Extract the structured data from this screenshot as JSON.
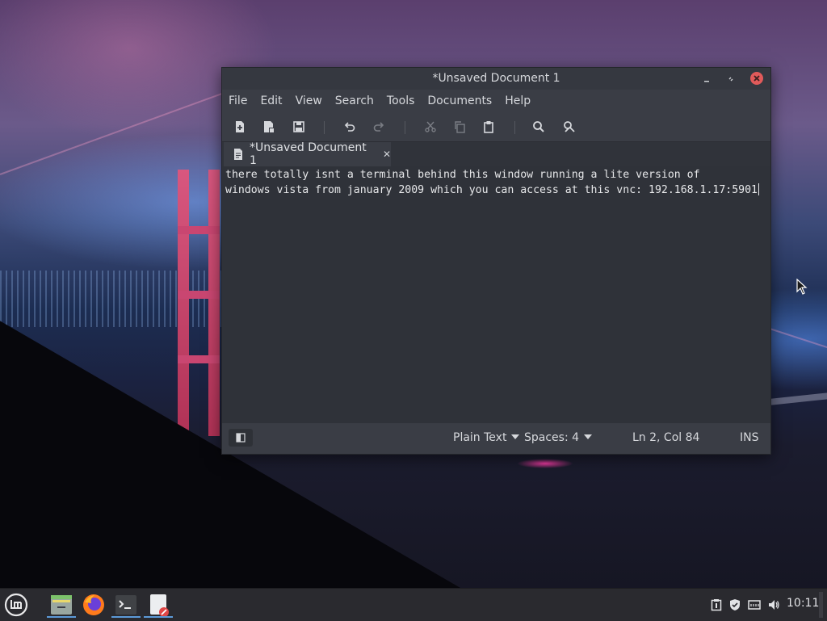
{
  "window": {
    "title": "*Unsaved Document 1",
    "menu": [
      "File",
      "Edit",
      "View",
      "Search",
      "Tools",
      "Documents",
      "Help"
    ],
    "tab_title": "*Unsaved Document 1",
    "content_lines": [
      "there totally isnt a terminal behind this window running a lite version of",
      "windows vista from january 2009 which you can access at this vnc: 192.168.1.17:5901"
    ],
    "status": {
      "language": "Plain Text",
      "spaces": "Spaces: 4",
      "position": "Ln 2, Col 84",
      "mode": "INS"
    }
  },
  "toolbar_icons": [
    "new-document-icon",
    "open-document-icon",
    "save-icon",
    "undo-icon",
    "redo-icon",
    "cut-icon",
    "copy-icon",
    "paste-icon",
    "search-icon",
    "tools-icon"
  ],
  "taskbar": {
    "clock": "10:11",
    "apps": [
      "menu-icon",
      "file-manager-icon",
      "firefox-icon",
      "terminal-icon",
      "text-editor-icon"
    ],
    "tray": [
      "clipboard-icon",
      "shield-icon",
      "network-icon",
      "volume-icon"
    ]
  },
  "colors": {
    "accent": "#5c9ad8",
    "close_button": "#e05a5a"
  }
}
